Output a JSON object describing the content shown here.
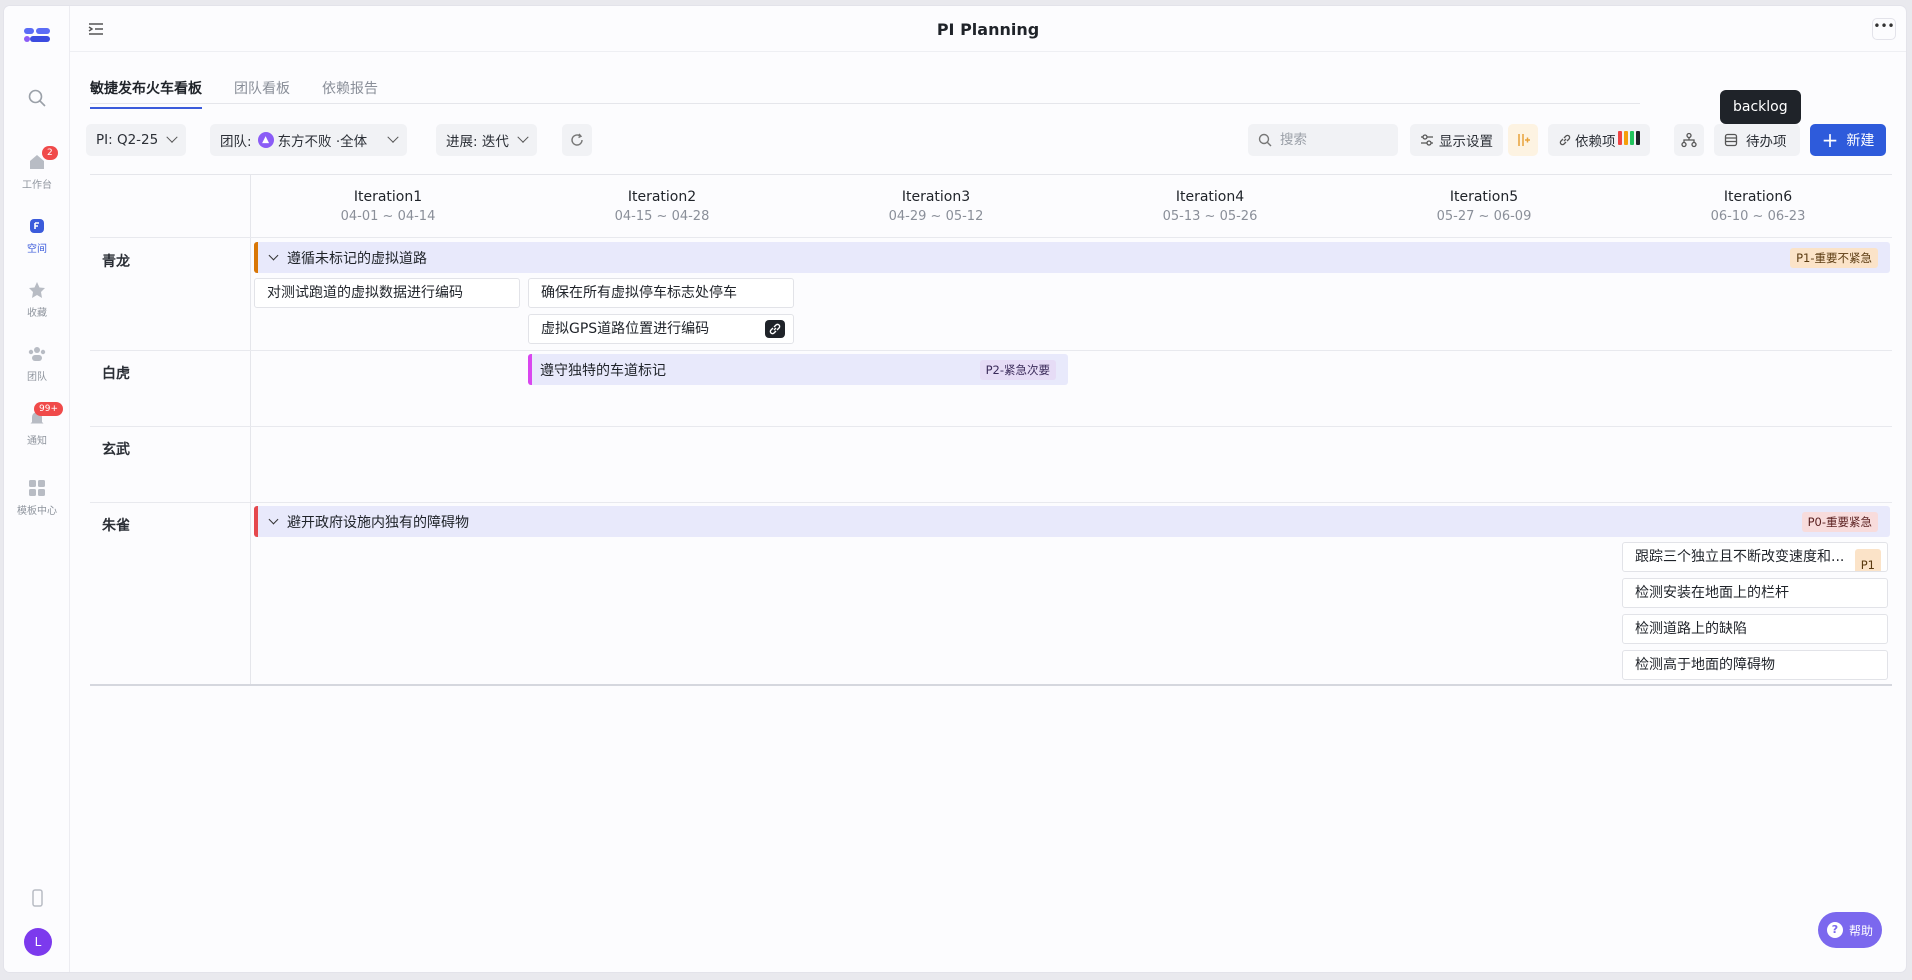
{
  "header": {
    "title": "PI Planning",
    "more_label": "•••"
  },
  "sidebar": {
    "items": [
      {
        "label": "工作台",
        "badge": "2"
      },
      {
        "label": "空间"
      },
      {
        "label": "收藏"
      },
      {
        "label": "团队"
      },
      {
        "label": "通知",
        "badge": "99+"
      },
      {
        "label": "模板中心"
      }
    ],
    "avatar_initial": "L"
  },
  "tabs": [
    "敏捷发布火车看板",
    "团队看板",
    "依赖报告"
  ],
  "toolbar": {
    "pi": "PI:  Q2-25",
    "team_prefix": "团队:",
    "team_value": "东方不败 ·全体",
    "progress": "进展:  迭代",
    "search_placeholder": "搜索",
    "display_settings": "显示设置",
    "dependencies": "依赖项",
    "backlog": "待办项",
    "new": "新建",
    "tooltip": "backlog"
  },
  "iterations": [
    {
      "name": "Iteration1",
      "dates": "04-01 ~ 04-14"
    },
    {
      "name": "Iteration2",
      "dates": "04-15 ~ 04-28"
    },
    {
      "name": "Iteration3",
      "dates": "04-29 ~ 05-12"
    },
    {
      "name": "Iteration4",
      "dates": "05-13 ~ 05-26"
    },
    {
      "name": "Iteration5",
      "dates": "05-27 ~ 06-09"
    },
    {
      "name": "Iteration6",
      "dates": "06-10 ~ 06-23"
    }
  ],
  "rows": [
    {
      "team": "青龙",
      "epic": {
        "title": "遵循未标记的虚拟道路",
        "priority": "P1-重要不紧急"
      },
      "stories": [
        "对测试跑道的虚拟数据进行编码",
        "确保在所有虚拟停车标志处停车",
        "虚拟GPS道路位置进行编码"
      ]
    },
    {
      "team": "白虎",
      "epic": {
        "title": "遵守独特的车道标记",
        "priority": "P2-紧急次要"
      }
    },
    {
      "team": "玄武"
    },
    {
      "team": "朱雀",
      "epic": {
        "title": "避开政府设施内独有的障碍物",
        "priority": "P0-重要紧急"
      },
      "stories": [
        "跟踪三个独立且不断改变速度和...",
        "检测安装在地面上的栏杆",
        "检测道路上的缺陷",
        "检测高于地面的障碍物"
      ],
      "story_tag": "P1"
    }
  ],
  "help_label": "帮助",
  "colors": {
    "accent": "#2e5bdb",
    "epic_bg": "#e8e9fb",
    "p0": "#e5484d",
    "p1": "#d97706",
    "p2": "#d946ef"
  }
}
